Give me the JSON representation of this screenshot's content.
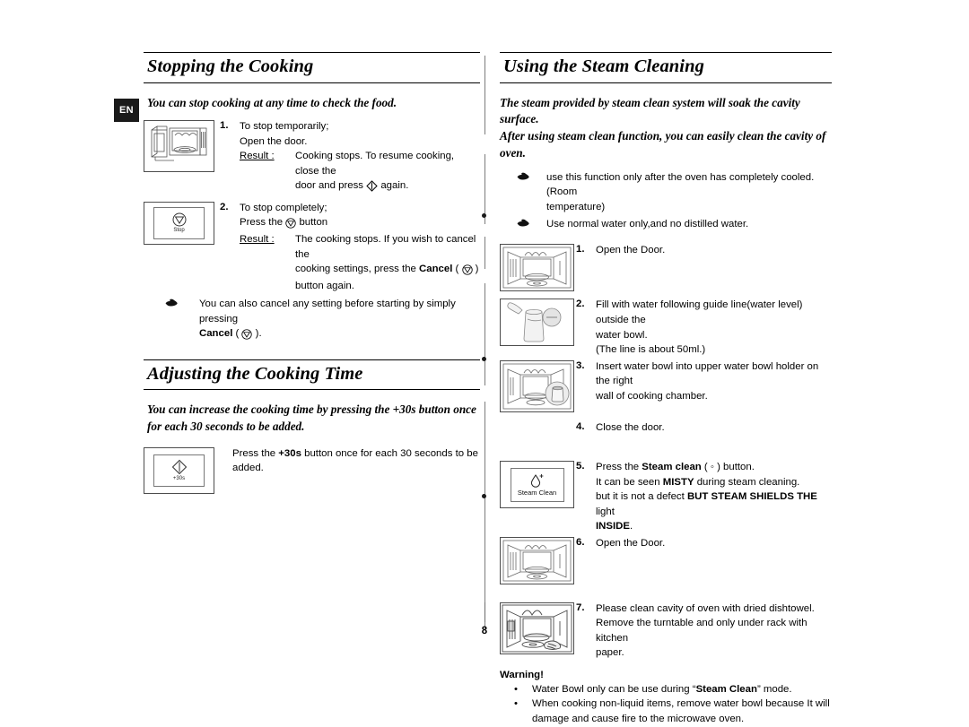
{
  "page": {
    "language_tab": "EN",
    "page_number": "8"
  },
  "left_column": {
    "section1": {
      "heading": "Stopping the Cooking",
      "intro": "You can stop cooking at any time to check the food.",
      "steps": [
        {
          "number": "1.",
          "thumb": "oven-door-open-side-illustration",
          "lines": [
            "To stop temporarily;",
            "Open the door."
          ],
          "result_label": "Result :",
          "result_lines": [
            "Cooking stops. To resume cooking, close the",
            "door and press ◇ again."
          ]
        },
        {
          "number": "2.",
          "thumb": "stop-button-illustration",
          "lines": [
            "To stop completely;",
            "Press the ⊘ button"
          ],
          "result_label": "Result :",
          "result_lines": [
            "The cooking stops. If you wish to cancel the",
            "cooking settings, press the Cancel ( ⊘ )",
            "button again."
          ]
        }
      ],
      "note": {
        "icon": "pointing-hand-icon",
        "line1": "You can also cancel any setting before starting by simply pressing",
        "line2_bold": "Cancel",
        "line2_rest": " ( ⊘ )."
      },
      "stop_button_label": "Stop"
    },
    "section2": {
      "heading": "Adjusting the Cooking Time",
      "intro_line1": "You can increase the cooking time by pressing the +30s button once",
      "intro_line2": "for each 30 seconds to be added.",
      "step": {
        "thumb": "plus-30s-button-illustration",
        "text_pre": "Press the ",
        "text_bold": "+30s",
        "text_post": " button once for each 30 seconds to be added."
      },
      "plus30s_button_label": "+30s"
    }
  },
  "right_column": {
    "heading": "Using the Steam Cleaning",
    "intro_lines": [
      "The steam provided by steam clean system will soak the cavity surface.",
      "After using steam clean function, you can easily clean the cavity of",
      "oven."
    ],
    "notes": [
      {
        "icon": "pointing-hand-icon",
        "lines": [
          "use this function only after the oven has completely cooled. (Room",
          "temperature)"
        ]
      },
      {
        "icon": "pointing-hand-icon",
        "lines": [
          "Use normal water only,and no distilled water."
        ]
      }
    ],
    "steps": [
      {
        "number": "1.",
        "thumb": "oven-cavity-open-illustration",
        "lines": [
          "Open the Door."
        ]
      },
      {
        "number": "2.",
        "thumb": "water-bowl-fill-illustration",
        "lines": [
          "Fill with water following guide line(water level) outside the",
          "water bowl.",
          "(The line is about 50ml.)"
        ]
      },
      {
        "number": "3.",
        "thumb": "insert-water-bowl-illustration",
        "lines": [
          "Insert water bowl into upper water bowl holder on the right",
          "wall of cooking chamber."
        ]
      },
      {
        "number": "4.",
        "thumb": "",
        "lines": [
          "Close the door."
        ]
      },
      {
        "number": "5.",
        "thumb": "steam-clean-button-illustration",
        "rich": [
          {
            "pre": "Press the ",
            "bold": "Steam clean",
            "post": " ( ◦ ) button."
          },
          {
            "pre": "It can be seen ",
            "bold": "MISTY",
            "post": " during steam cleaning."
          },
          {
            "pre": "but it is not a defect ",
            "bold": "BUT STEAM SHIELDS THE",
            "post": " light"
          },
          {
            "pre": "",
            "bold": "INSIDE",
            "post": "."
          }
        ]
      },
      {
        "number": "6.",
        "thumb": "oven-cavity-open-illustration",
        "lines": [
          "Open the Door."
        ]
      },
      {
        "number": "7.",
        "thumb": "clean-cavity-dishtowel-illustration",
        "lines": [
          "Please clean cavity of oven with dried dishtowel.",
          "Remove the turntable and only under rack with kitchen",
          "paper."
        ]
      }
    ],
    "steam_clean_button_label": "Steam Clean",
    "warning": {
      "title": "Warning!",
      "items": [
        {
          "pre": "Water Bowl only can be use during “",
          "bold": "Steam Clean",
          "post": "” mode."
        },
        {
          "pre": "When cooking non-liquid items, remove water bowl because It will",
          "bold": "",
          "post": ""
        },
        {
          "pre": "damage and cause fire to the microwave oven.",
          "bold": "",
          "post": ""
        }
      ]
    }
  },
  "colors": {
    "text": "#000000",
    "rule": "#000000",
    "frame": "#4d4d4d",
    "tab_bg": "#1a1a1a",
    "tab_fg": "#ffffff"
  }
}
